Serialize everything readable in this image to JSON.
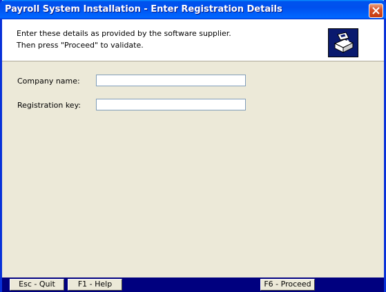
{
  "window": {
    "title": "Payroll System Installation - Enter Registration Details"
  },
  "header": {
    "line1": "Enter these details as provided by the software supplier.",
    "line2": "Then press \"Proceed\" to validate.",
    "logo_icon": "install-software-icon"
  },
  "form": {
    "company_name": {
      "label": "Company name:",
      "value": "",
      "placeholder": ""
    },
    "registration_key": {
      "label": "Registration key:",
      "value": "",
      "placeholder": ""
    }
  },
  "footer": {
    "quit_label": "Esc - Quit",
    "help_label": "F1 - Help",
    "proceed_label": "F6 - Proceed"
  },
  "colors": {
    "title_bar": "#0053ee",
    "footer_bar": "#00007f",
    "body_bg": "#ece9d8",
    "close_button": "#d8532a"
  }
}
